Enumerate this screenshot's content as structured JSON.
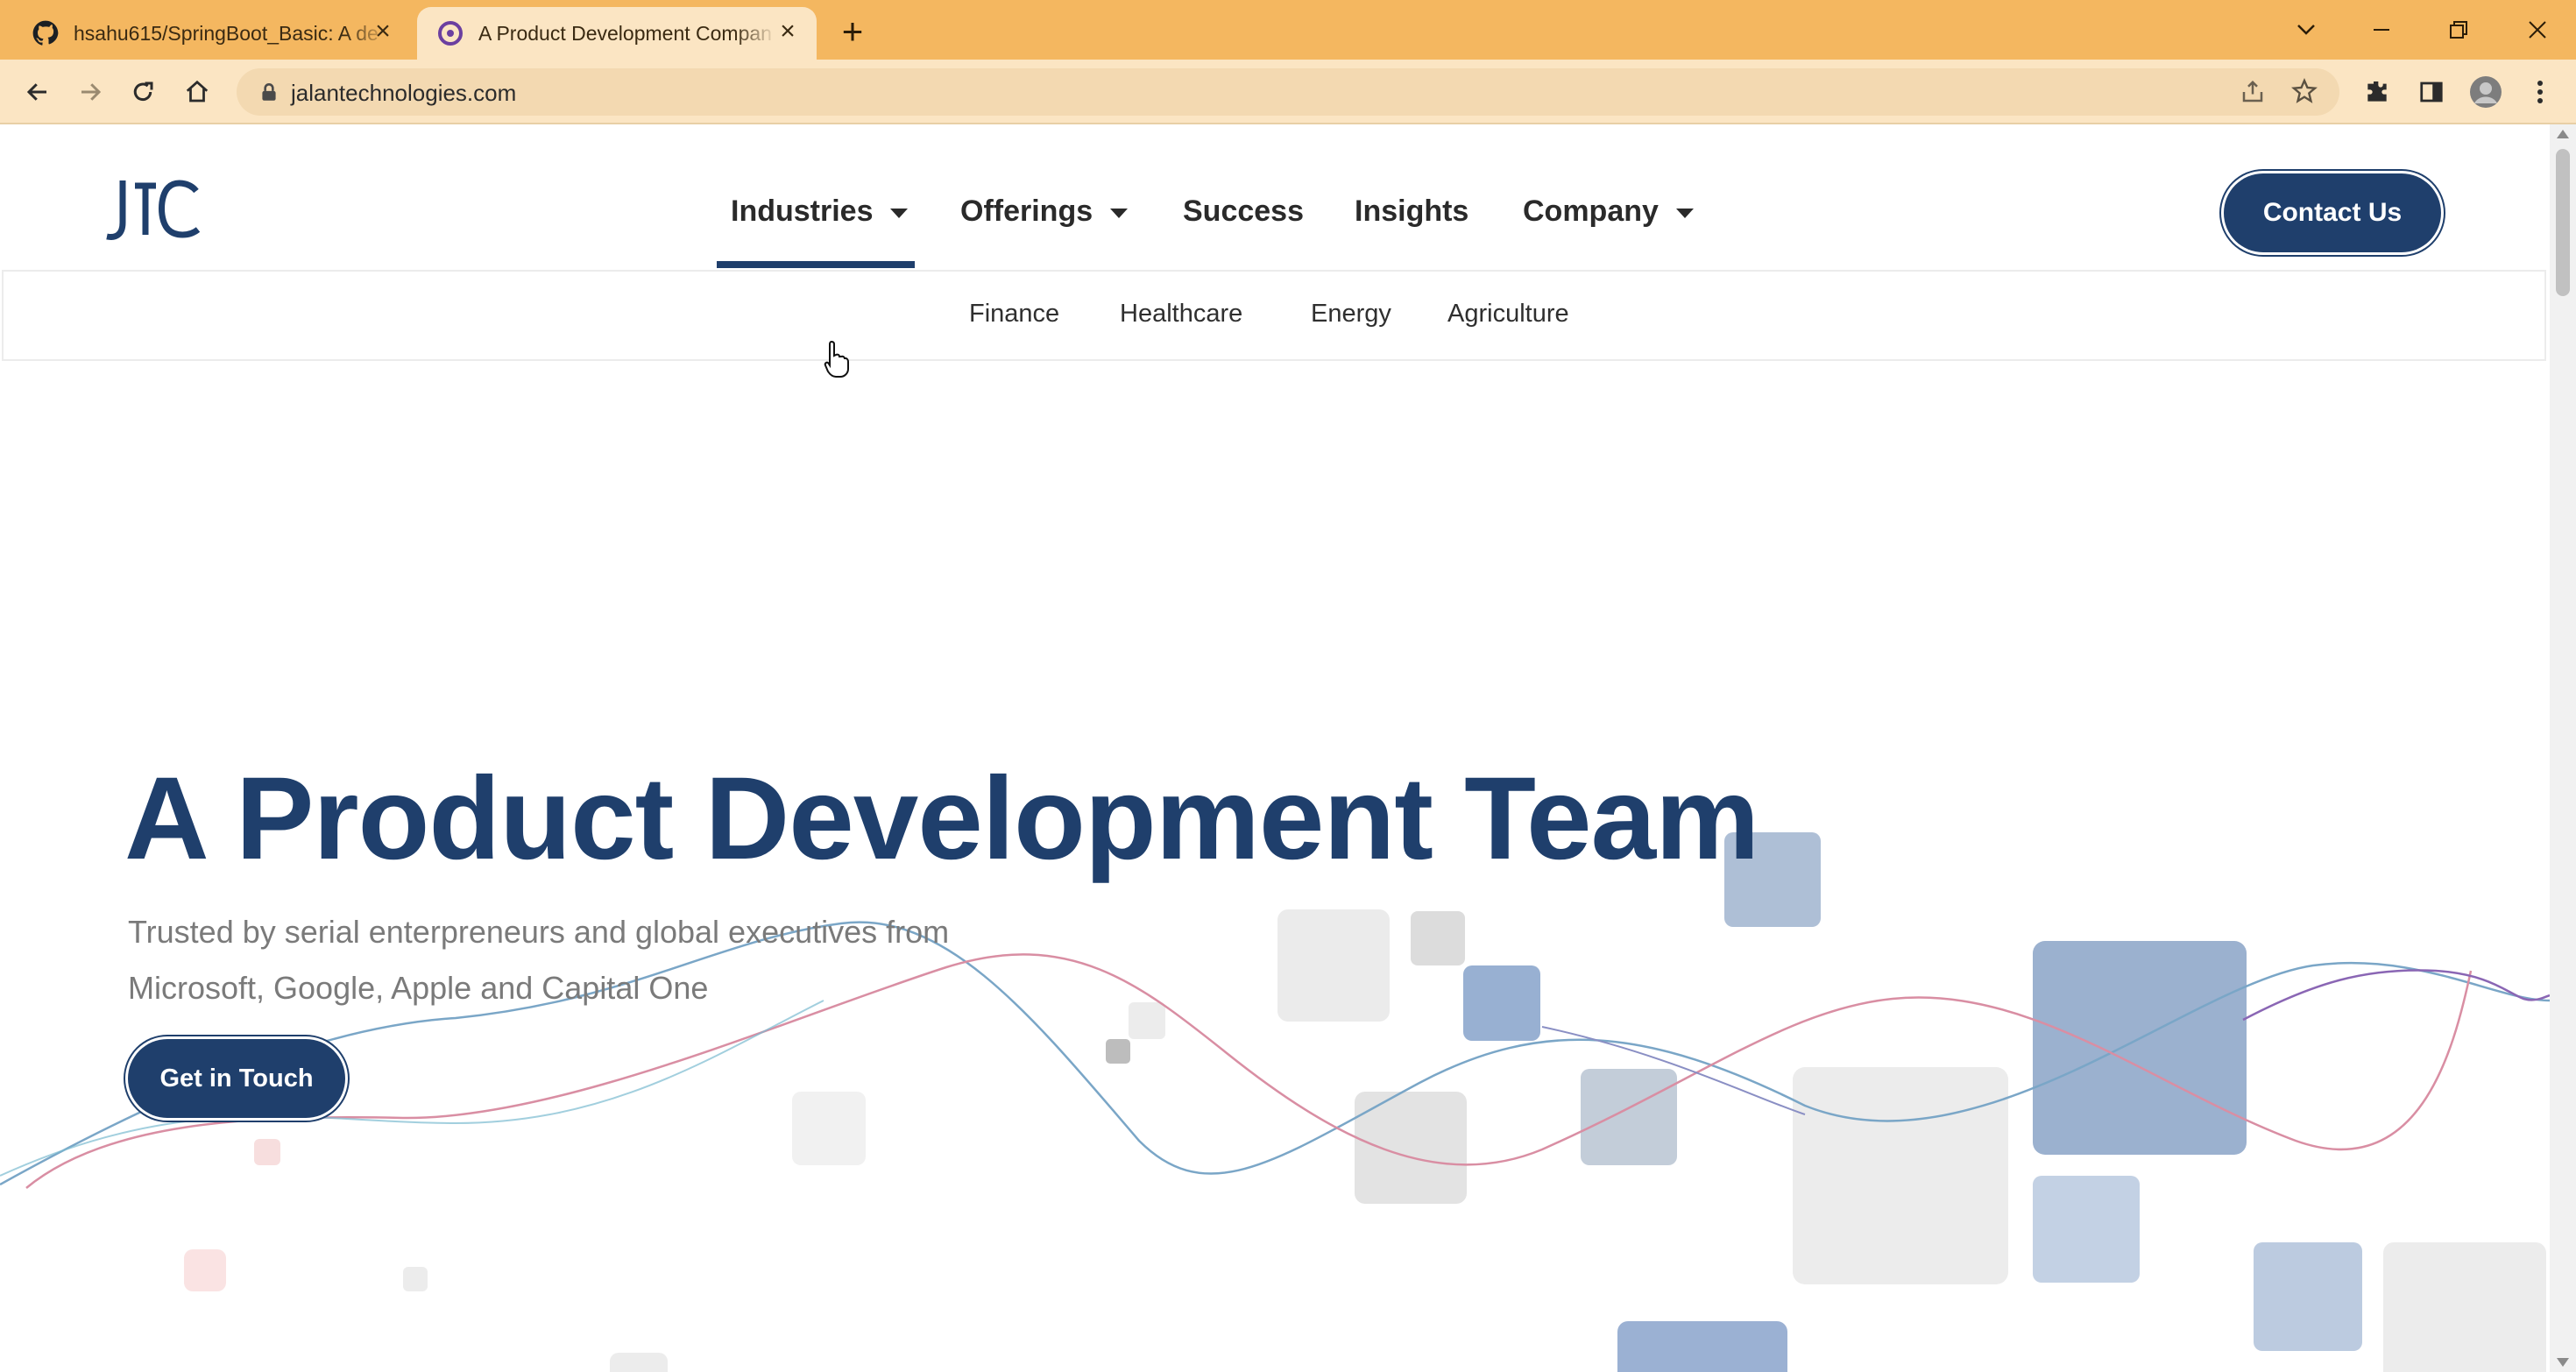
{
  "browser": {
    "tabs": [
      {
        "title": "hsahu615/SpringBoot_Basic: A de",
        "icon": "github-icon",
        "active": false
      },
      {
        "title": "A Product Development Compan",
        "icon": "site-favicon",
        "active": true
      }
    ],
    "close_glyph": "×",
    "new_tab_glyph": "+",
    "url": "jalantechnologies.com",
    "colors": {
      "tabstrip": "#f4b760",
      "toolbar": "#fbe5c3",
      "omnibox": "#f3d9b1"
    }
  },
  "site": {
    "logo_text": "JTC",
    "nav": [
      {
        "label": "Industries",
        "dropdown": true,
        "active": true
      },
      {
        "label": "Offerings",
        "dropdown": true,
        "active": false
      },
      {
        "label": "Success",
        "dropdown": false,
        "active": false
      },
      {
        "label": "Insights",
        "dropdown": false,
        "active": false
      },
      {
        "label": "Company",
        "dropdown": true,
        "active": false
      }
    ],
    "contact_label": "Contact Us",
    "industries_submenu": [
      "Finance",
      "Healthcare",
      "Energy",
      "Agriculture"
    ],
    "hero": {
      "title": "A Product Development Team",
      "subtitle_line1": "Trusted by serial enterpreneurs and global executives from",
      "subtitle_line2": "Microsoft, Google, Apple and Capital One",
      "cta_label": "Get in Touch"
    },
    "colors": {
      "brand_navy": "#1f3f6c",
      "subtitle_gray": "#7a7a7a"
    }
  }
}
